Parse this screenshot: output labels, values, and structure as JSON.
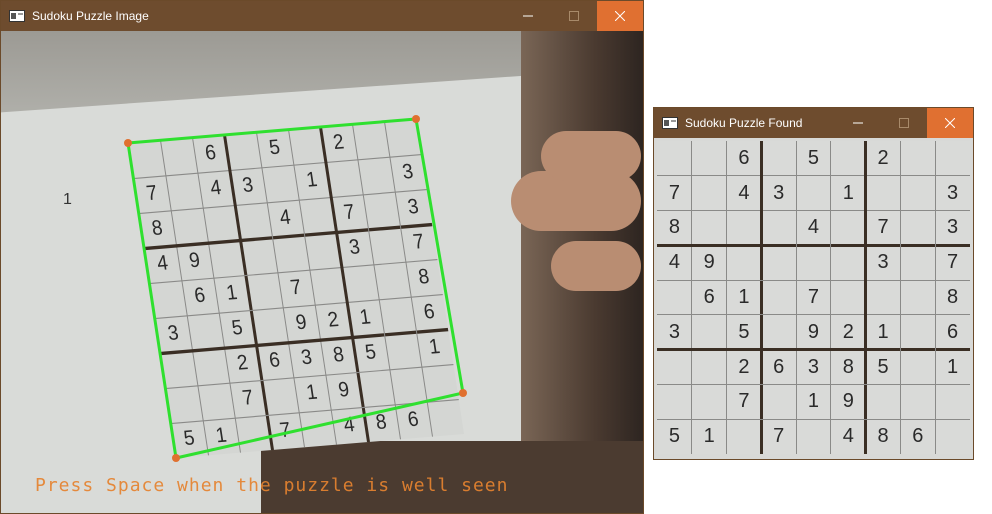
{
  "window_main": {
    "title": "Sudoku Puzzle Image",
    "side_label": "1",
    "prompt": "Press Space when the puzzle is well seen"
  },
  "window_found": {
    "title": "Sudoku Puzzle Found"
  },
  "colors": {
    "titlebar": "#6e4c2e",
    "close_button": "#e07031",
    "detection_outline": "#2fe02f",
    "corner_marker": "#e0702f",
    "prompt_text": "#e6832f"
  },
  "icons": {
    "app": "window-app-icon",
    "minimize": "minimize-icon",
    "maximize": "maximize-icon",
    "close": "close-icon"
  },
  "sudoku": [
    [
      "",
      "",
      "6",
      "",
      "5",
      "",
      "2",
      "",
      ""
    ],
    [
      "7",
      "",
      "4",
      "3",
      "",
      "1",
      "",
      "",
      "3"
    ],
    [
      "8",
      "",
      "",
      "",
      "4",
      "",
      "7",
      "",
      "3"
    ],
    [
      "4",
      "9",
      "",
      "",
      "",
      "",
      "3",
      "",
      "7"
    ],
    [
      "",
      "6",
      "1",
      "",
      "7",
      "",
      "",
      "",
      "8"
    ],
    [
      "3",
      "",
      "5",
      "",
      "9",
      "2",
      "1",
      "",
      "6"
    ],
    [
      "",
      "",
      "2",
      "6",
      "3",
      "8",
      "5",
      "",
      "1"
    ],
    [
      "",
      "",
      "7",
      "",
      "1",
      "9",
      "",
      "",
      ""
    ],
    [
      "5",
      "1",
      "",
      "7",
      "",
      "4",
      "8",
      "6",
      ""
    ]
  ]
}
